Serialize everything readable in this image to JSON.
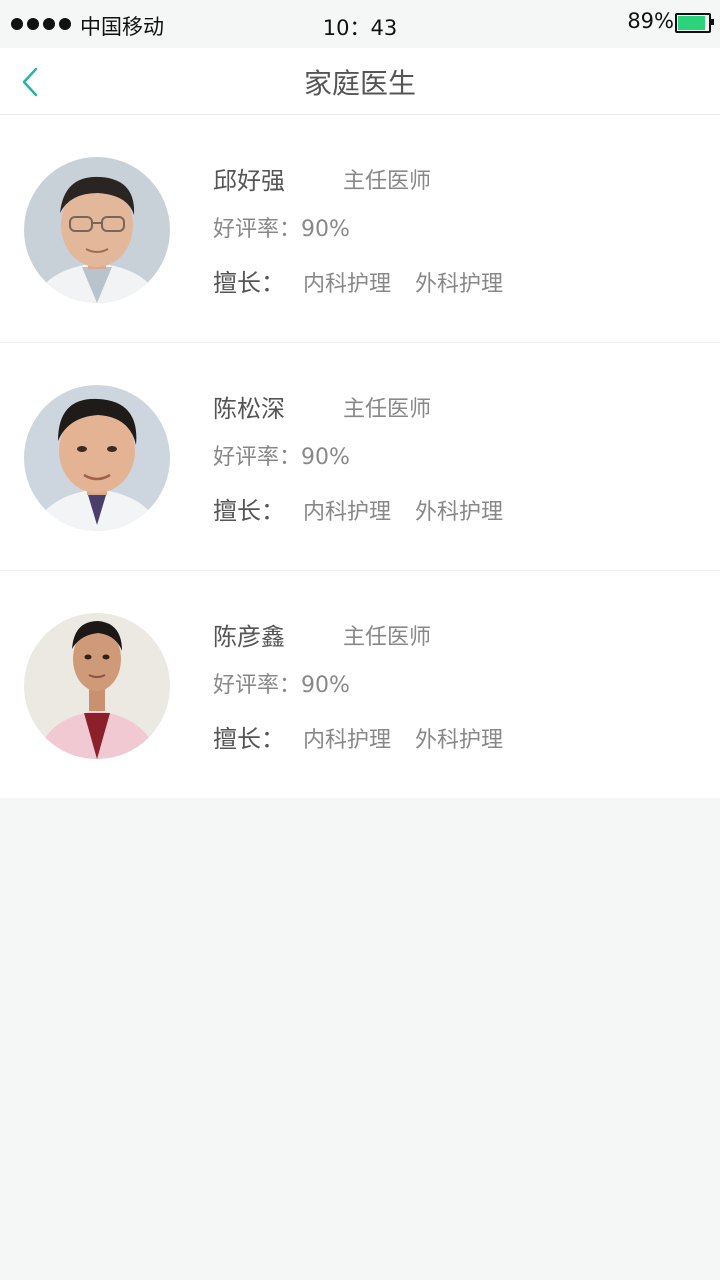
{
  "status_bar": {
    "carrier": "中国移动",
    "time": "10：43",
    "battery_percent": "89%",
    "battery_level": 0.89,
    "battery_color": "#2bd37a"
  },
  "nav": {
    "title": "家庭医生",
    "back_icon": "chevron-left-icon",
    "accent_color": "#1fb5a2"
  },
  "doctors": [
    {
      "name": "邱好强",
      "title": "主任医师",
      "rating": "好评率：90%",
      "specialty_label": "擅长：",
      "specialties": [
        "内科护理",
        "外科护理"
      ]
    },
    {
      "name": "陈松深",
      "title": "主任医师",
      "rating": "好评率：90%",
      "specialty_label": "擅长：",
      "specialties": [
        "内科护理",
        "外科护理"
      ]
    },
    {
      "name": "陈彦鑫",
      "title": "主任医师",
      "rating": "好评率：90%",
      "specialty_label": "擅长：",
      "specialties": [
        "内科护理",
        "外科护理"
      ]
    }
  ]
}
